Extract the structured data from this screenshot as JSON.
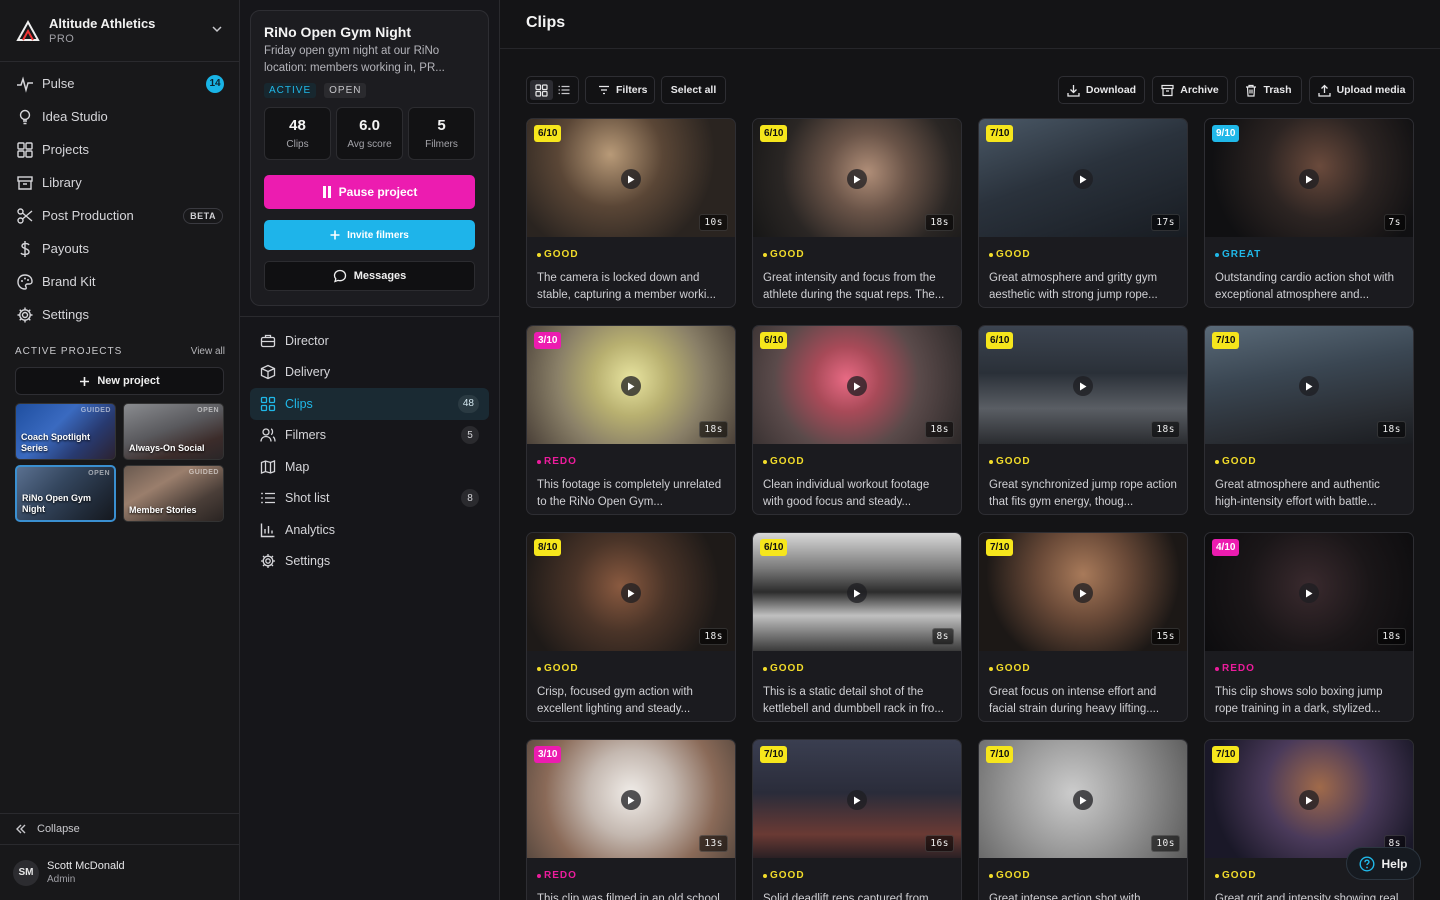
{
  "workspace": {
    "name": "Altitude Athletics",
    "plan": "PRO"
  },
  "nav": [
    {
      "label": "Pulse",
      "icon": "pulse-icon",
      "badge": "14"
    },
    {
      "label": "Idea Studio",
      "icon": "lightbulb-icon"
    },
    {
      "label": "Projects",
      "icon": "grid-icon"
    },
    {
      "label": "Library",
      "icon": "archive-icon"
    },
    {
      "label": "Post Production",
      "icon": "scissors-icon",
      "tag": "BETA"
    },
    {
      "label": "Payouts",
      "icon": "dollar-icon"
    },
    {
      "label": "Brand Kit",
      "icon": "palette-icon"
    },
    {
      "label": "Settings",
      "icon": "gear-icon"
    }
  ],
  "active_projects": {
    "heading": "ACTIVE PROJECTS",
    "view_all": "View all",
    "new_project": "New project",
    "items": [
      {
        "name": "Coach Spotlight Series",
        "status": "GUIDED"
      },
      {
        "name": "Always-On Social",
        "status": "OPEN"
      },
      {
        "name": "RiNo Open Gym Night",
        "status": "OPEN"
      },
      {
        "name": "Member Stories",
        "status": "GUIDED"
      }
    ]
  },
  "collapse": "Collapse",
  "user": {
    "initials": "SM",
    "name": "Scott McDonald",
    "role": "Admin"
  },
  "project": {
    "title": "RiNo Open Gym Night",
    "description": "Friday open gym night at our RiNo location: members working in, PR...",
    "status_tags": [
      "ACTIVE",
      "OPEN"
    ],
    "stats": [
      {
        "value": "48",
        "label": "Clips"
      },
      {
        "value": "6.0",
        "label": "Avg score"
      },
      {
        "value": "5",
        "label": "Filmers"
      }
    ],
    "pause_label": "Pause project",
    "invite_label": "Invite filmers",
    "messages_label": "Messages"
  },
  "project_nav": [
    {
      "label": "Director",
      "icon": "briefcase-icon"
    },
    {
      "label": "Delivery",
      "icon": "package-icon"
    },
    {
      "label": "Clips",
      "icon": "grid-icon",
      "count": "48",
      "active": true
    },
    {
      "label": "Filmers",
      "icon": "users-icon",
      "count": "5"
    },
    {
      "label": "Map",
      "icon": "map-icon"
    },
    {
      "label": "Shot list",
      "icon": "list-icon",
      "count": "8"
    },
    {
      "label": "Analytics",
      "icon": "chart-icon"
    },
    {
      "label": "Settings",
      "icon": "gear-icon"
    }
  ],
  "main": {
    "title": "Clips",
    "toolbar": {
      "filters": "Filters",
      "select_all": "Select all",
      "download": "Download",
      "archive": "Archive",
      "trash": "Trash",
      "upload": "Upload media"
    }
  },
  "colors": {
    "accent_cyan": "#20b8e8",
    "accent_magenta": "#ec1cb0",
    "score_yellow": "#f6e61c"
  },
  "clips": [
    {
      "score": "6/10",
      "duration": "10s",
      "rating": "GOOD",
      "description": "The camera is locked down and stable, capturing a member worki..."
    },
    {
      "score": "6/10",
      "duration": "18s",
      "rating": "GOOD",
      "description": "Great intensity and focus from the athlete during the squat reps. The..."
    },
    {
      "score": "7/10",
      "duration": "17s",
      "rating": "GOOD",
      "description": "Great atmosphere and gritty gym aesthetic with strong jump rope..."
    },
    {
      "score": "9/10",
      "duration": "7s",
      "rating": "GREAT",
      "description": "Outstanding cardio action shot with exceptional atmosphere and..."
    },
    {
      "score": "3/10",
      "duration": "18s",
      "rating": "REDO",
      "description": "This footage is completely unrelated to the RiNo Open Gym..."
    },
    {
      "score": "6/10",
      "duration": "18s",
      "rating": "GOOD",
      "description": "Clean individual workout footage with good focus and steady..."
    },
    {
      "score": "6/10",
      "duration": "18s",
      "rating": "GOOD",
      "description": "Great synchronized jump rope action that fits gym energy, thoug..."
    },
    {
      "score": "7/10",
      "duration": "18s",
      "rating": "GOOD",
      "description": "Great atmosphere and authentic high-intensity effort with battle..."
    },
    {
      "score": "8/10",
      "duration": "18s",
      "rating": "GOOD",
      "description": "Crisp, focused gym action with excellent lighting and steady..."
    },
    {
      "score": "6/10",
      "duration": "8s",
      "rating": "GOOD",
      "description": "This is a static detail shot of the kettlebell and dumbbell rack in fro..."
    },
    {
      "score": "7/10",
      "duration": "15s",
      "rating": "GOOD",
      "description": "Great focus on intense effort and facial strain during heavy lifting...."
    },
    {
      "score": "4/10",
      "duration": "18s",
      "rating": "REDO",
      "description": "This clip shows solo boxing jump rope training in a dark, stylized..."
    },
    {
      "score": "3/10",
      "duration": "13s",
      "rating": "REDO",
      "description": "This clip was filmed in an old school"
    },
    {
      "score": "7/10",
      "duration": "16s",
      "rating": "GOOD",
      "description": "Solid deadlift reps captured from"
    },
    {
      "score": "7/10",
      "duration": "10s",
      "rating": "GOOD",
      "description": "Great intense action shot with"
    },
    {
      "score": "7/10",
      "duration": "8s",
      "rating": "GOOD",
      "description": "Great grit and intensity showing real"
    }
  ],
  "help": "Help"
}
